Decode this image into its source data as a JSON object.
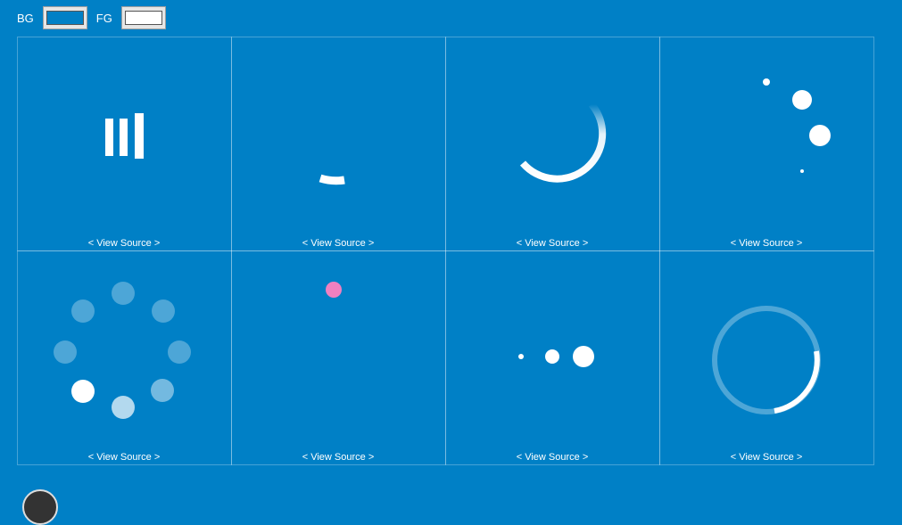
{
  "controls": {
    "bg_label": "BG",
    "fg_label": "FG",
    "bg_color": "#0080c6",
    "fg_color": "#ffffff"
  },
  "colors": {
    "background": "#0080c6",
    "foreground": "#ffffff",
    "accent_dot": "#f080c0"
  },
  "loaders": [
    {
      "name": "bars-loader",
      "link": "< View Source >"
    },
    {
      "name": "arc-small-loader",
      "link": "< View Source >"
    },
    {
      "name": "arc-gradient-loader",
      "link": "< View Source >"
    },
    {
      "name": "dots-circle-growing-loader",
      "link": "< View Source >"
    },
    {
      "name": "dots-ring-fade-loader",
      "link": "< View Source >"
    },
    {
      "name": "pink-dot-loader",
      "link": "< View Source >"
    },
    {
      "name": "three-dots-growing-loader",
      "link": "< View Source >"
    },
    {
      "name": "ring-progress-loader",
      "link": "< View Source >"
    }
  ]
}
